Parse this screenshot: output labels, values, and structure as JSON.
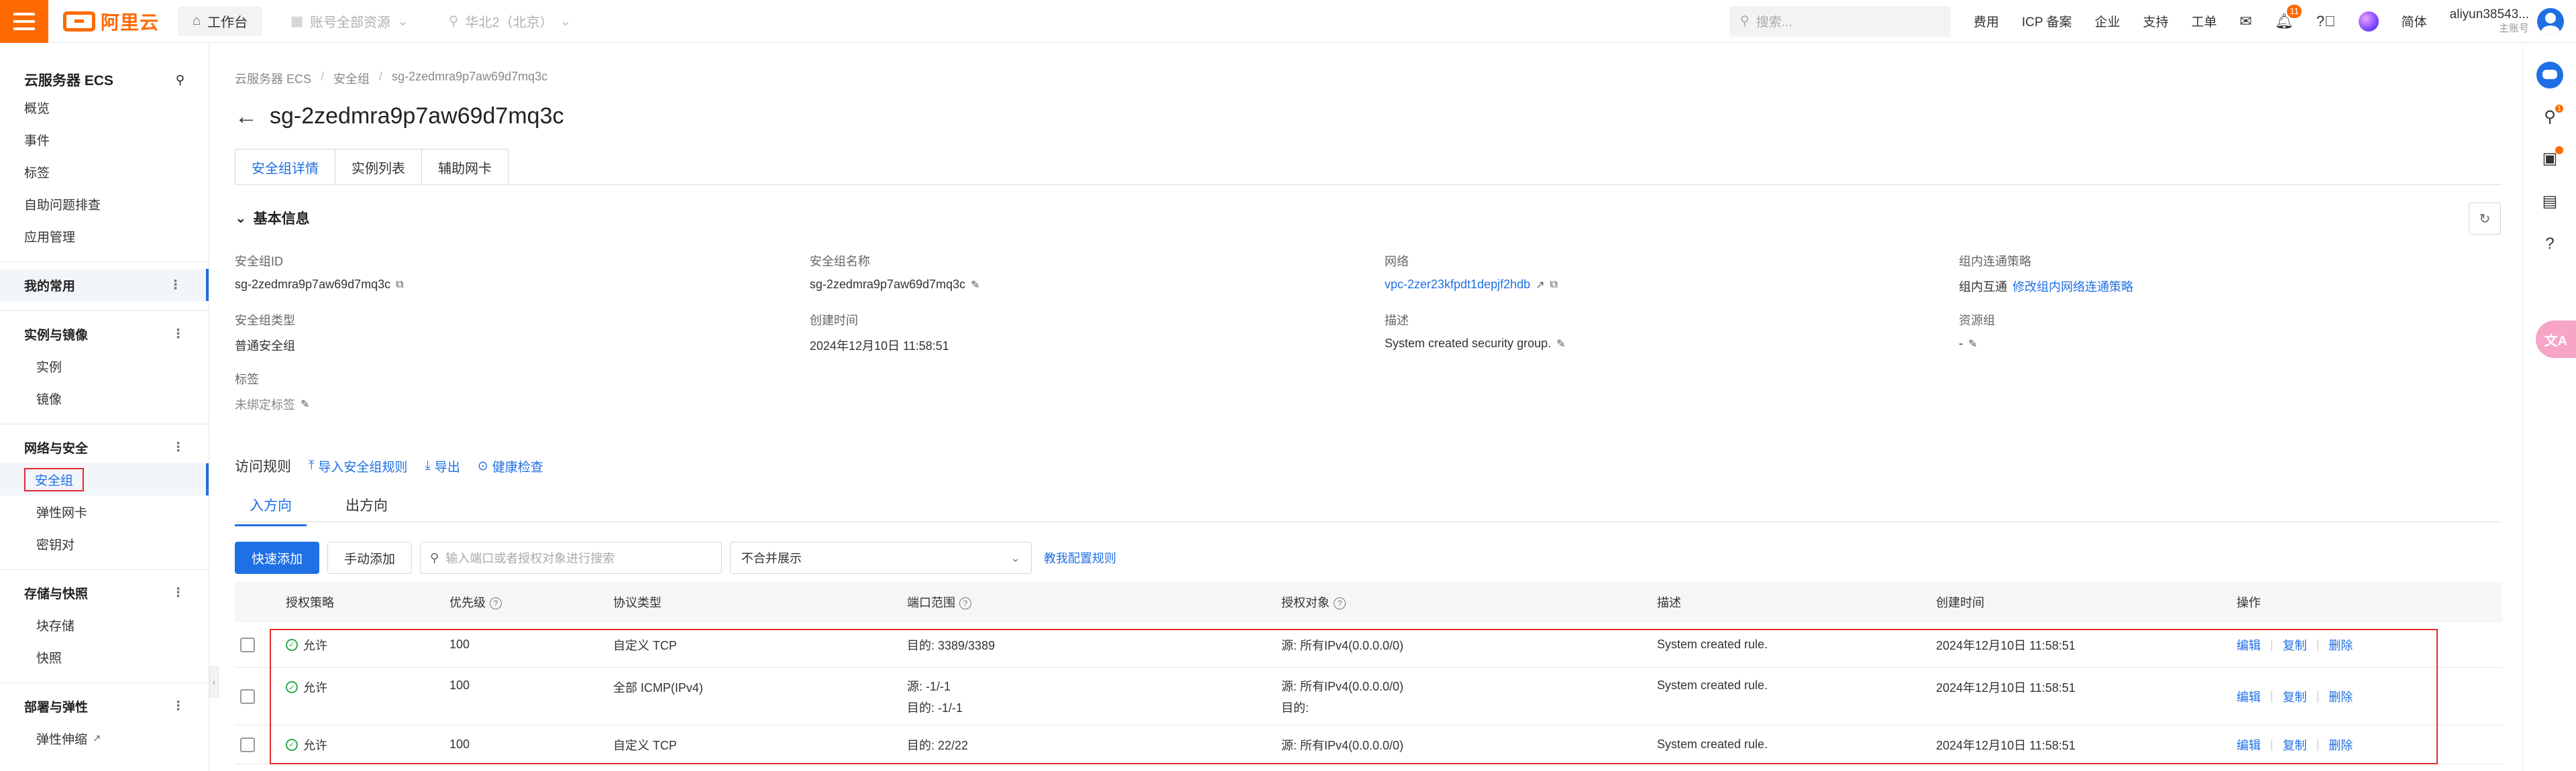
{
  "topbar": {
    "logo_text": "阿里云",
    "workbench": "工作台",
    "account_resources": "账号全部资源",
    "region": "华北2（北京）",
    "search_placeholder": "搜索...",
    "links": [
      "费用",
      "ICP 备案",
      "企业",
      "支持",
      "工单"
    ],
    "notification_count": "11",
    "language": "简体",
    "user_name": "aliyun38543...",
    "user_role": "主账号"
  },
  "sidebar": {
    "title": "云服务器 ECS",
    "top_items": [
      "概览",
      "事件",
      "标签",
      "自助问题排查",
      "应用管理"
    ],
    "favorites": "我的常用",
    "groups": [
      {
        "title": "实例与镜像",
        "items": [
          "实例",
          "镜像"
        ]
      },
      {
        "title": "网络与安全",
        "items": [
          "安全组",
          "弹性网卡",
          "密钥对"
        ]
      },
      {
        "title": "存储与快照",
        "items": [
          "块存储",
          "快照"
        ]
      },
      {
        "title": "部署与弹性",
        "items": [
          "弹性伸缩"
        ]
      }
    ]
  },
  "right_rail": {
    "badge": "1",
    "translate_label": "文A"
  },
  "breadcrumb": [
    "云服务器 ECS",
    "安全组",
    "sg-2zedmra9p7aw69d7mq3c"
  ],
  "page_title": "sg-2zedmra9p7aw69d7mq3c",
  "tabs": [
    "安全组详情",
    "实例列表",
    "辅助网卡"
  ],
  "basic_info": {
    "section_title": "基本信息",
    "fields": {
      "sg_id": {
        "label": "安全组ID",
        "value": "sg-2zedmra9p7aw69d7mq3c"
      },
      "sg_name": {
        "label": "安全组名称",
        "value": "sg-2zedmra9p7aw69d7mq3c"
      },
      "network": {
        "label": "网络",
        "value": "vpc-2zer23kfpdt1depjf2hdb"
      },
      "intra_policy": {
        "label": "组内连通策略",
        "value": "组内互通",
        "action": "修改组内网络连通策略"
      },
      "sg_type": {
        "label": "安全组类型",
        "value": "普通安全组"
      },
      "created": {
        "label": "创建时间",
        "value": "2024年12月10日 11:58:51"
      },
      "description": {
        "label": "描述",
        "value": "System created security group."
      },
      "resource_group": {
        "label": "资源组",
        "value": "-"
      },
      "tags": {
        "label": "标签",
        "value": "未绑定标签"
      }
    }
  },
  "rules": {
    "title": "访问规则",
    "import": "导入安全组规则",
    "export": "导出",
    "health_check": "健康检查",
    "directions": [
      "入方向",
      "出方向"
    ],
    "quick_add": "快速添加",
    "manual_add": "手动添加",
    "search_placeholder": "输入端口或者授权对象进行搜索",
    "merge_select": "不合并展示",
    "teach_link": "教我配置规则",
    "columns": [
      "授权策略",
      "优先级",
      "协议类型",
      "端口范围",
      "授权对象",
      "描述",
      "创建时间",
      "操作"
    ],
    "rows": [
      {
        "policy": "允许",
        "priority": "100",
        "protocol": "自定义 TCP",
        "port": [
          "目的: 3389/3389"
        ],
        "target": [
          "源: 所有IPv4(0.0.0.0/0)"
        ],
        "desc": "System created rule.",
        "time": "2024年12月10日 11:58:51"
      },
      {
        "policy": "允许",
        "priority": "100",
        "protocol": "全部 ICMP(IPv4)",
        "port": [
          "源: -1/-1",
          "目的: -1/-1"
        ],
        "target": [
          "源: 所有IPv4(0.0.0.0/0)",
          "目的:"
        ],
        "desc": "System created rule.",
        "time": "2024年12月10日 11:58:51"
      },
      {
        "policy": "允许",
        "priority": "100",
        "protocol": "自定义 TCP",
        "port": [
          "目的: 22/22"
        ],
        "target": [
          "源: 所有IPv4(0.0.0.0/0)"
        ],
        "desc": "System created rule.",
        "time": "2024年12月10日 11:58:51"
      }
    ],
    "ops": [
      "编辑",
      "复制",
      "删除"
    ]
  }
}
